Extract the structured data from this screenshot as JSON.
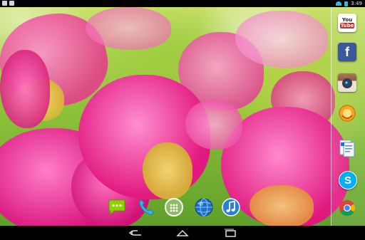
{
  "status_bar": {
    "time": "3:49",
    "notification_icons": [
      "gallery-icon",
      "mail-icon"
    ],
    "system_icons": [
      "wifi-icon",
      "battery-icon"
    ],
    "accent_color": "#33b5e5"
  },
  "right_dock": {
    "apps": [
      {
        "name": "youtube",
        "label": "You Tube",
        "label_you": "You",
        "label_tube": "Tube",
        "color": "#c4302b"
      },
      {
        "name": "facebook",
        "label": "f",
        "color": "#3b5998"
      },
      {
        "name": "instagram",
        "color": "#8a5a44"
      },
      {
        "name": "aim",
        "color": "#f5a623"
      },
      {
        "name": "documents",
        "color": "#ffffff"
      },
      {
        "name": "skype",
        "label": "S",
        "color": "#00aff0"
      },
      {
        "name": "chrome",
        "color": "#4285f4"
      }
    ]
  },
  "bottom_dock": {
    "apps": [
      {
        "name": "messaging",
        "color": "#7cc400"
      },
      {
        "name": "phone",
        "color": "#33b5e5"
      },
      {
        "name": "app-drawer",
        "color": "#ffffff"
      },
      {
        "name": "browser",
        "color": "#1e6fc7"
      },
      {
        "name": "music",
        "color": "#2a7fd6"
      }
    ]
  },
  "nav_bar": {
    "buttons": [
      "back",
      "home",
      "recents"
    ]
  }
}
